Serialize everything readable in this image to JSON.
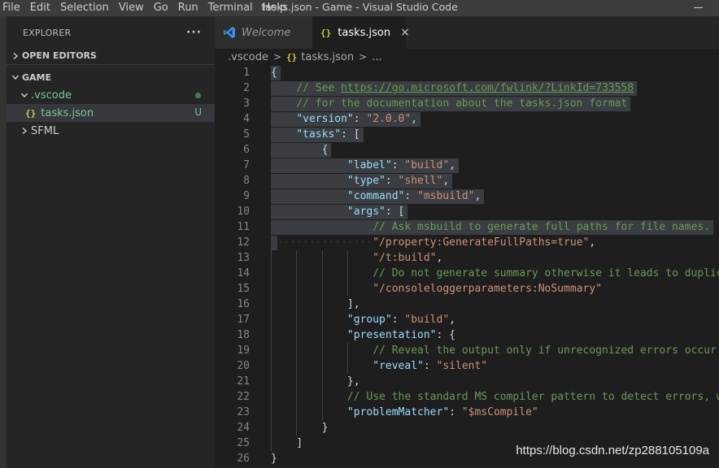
{
  "menu": [
    "File",
    "Edit",
    "Selection",
    "View",
    "Go",
    "Run",
    "Terminal",
    "Help"
  ],
  "window_title": "tasks.json - Game - Visual Studio Code",
  "sidebar": {
    "title": "EXPLORER",
    "more": "···",
    "open_editors": "OPEN EDITORS",
    "workspace": "GAME",
    "tree": [
      {
        "label": ".vscode",
        "type": "folder",
        "expanded": true,
        "status": "modified-dot"
      },
      {
        "label": "tasks.json",
        "type": "file",
        "status": "U",
        "selected": true
      },
      {
        "label": "SFML",
        "type": "folder",
        "expanded": false
      }
    ]
  },
  "tabs": [
    {
      "label": "Welcome",
      "icon": "vscode-icon",
      "active": false
    },
    {
      "label": "tasks.json",
      "icon": "json-icon",
      "active": true,
      "close": "×"
    }
  ],
  "breadcrumb": [
    ".vscode",
    "tasks.json",
    "..."
  ],
  "editor": {
    "lines": [
      {
        "n": "1",
        "text": "{"
      },
      {
        "n": "2",
        "text": "    // See https://go.microsoft.com/fwlink/?LinkId=733558"
      },
      {
        "n": "3",
        "text": "    // for the documentation about the tasks.json format"
      },
      {
        "n": "4",
        "text": "    \"version\": \"2.0.0\","
      },
      {
        "n": "5",
        "text": "    \"tasks\": ["
      },
      {
        "n": "6",
        "text": "        {"
      },
      {
        "n": "7",
        "text": "            \"label\": \"build\","
      },
      {
        "n": "8",
        "text": "            \"type\": \"shell\","
      },
      {
        "n": "9",
        "text": "            \"command\": \"msbuild\","
      },
      {
        "n": "10",
        "text": "            \"args\": ["
      },
      {
        "n": "11",
        "text": "                // Ask msbuild to generate full paths for file names."
      },
      {
        "n": "12",
        "text": "                \"/property:GenerateFullPaths=true\","
      },
      {
        "n": "13",
        "text": "                \"/t:build\","
      },
      {
        "n": "14",
        "text": "                // Do not generate summary otherwise it leads to duplica"
      },
      {
        "n": "15",
        "text": "                \"/consoleloggerparameters:NoSummary\""
      },
      {
        "n": "16",
        "text": "            ],"
      },
      {
        "n": "17",
        "text": "            \"group\": \"build\","
      },
      {
        "n": "18",
        "text": "            \"presentation\": {"
      },
      {
        "n": "19",
        "text": "                // Reveal the output only if unrecognized errors occur."
      },
      {
        "n": "20",
        "text": "                \"reveal\": \"silent\""
      },
      {
        "n": "21",
        "text": "            },"
      },
      {
        "n": "22",
        "text": "            // Use the standard MS compiler pattern to detect errors, wa"
      },
      {
        "n": "23",
        "text": "            \"problemMatcher\": \"$msCompile\""
      },
      {
        "n": "24",
        "text": "        }"
      },
      {
        "n": "25",
        "text": "    ]"
      },
      {
        "n": "26",
        "text": "}"
      }
    ],
    "selected_lines": [
      "1",
      "2",
      "3",
      "4",
      "5",
      "6",
      "7",
      "8",
      "9",
      "10",
      "11",
      "12"
    ]
  },
  "watermark": "https://blog.csdn.net/zp288105109a",
  "colors": {
    "editor_bg": "#1e1e1e",
    "sidebar_bg": "#252526",
    "titlebar_bg": "#3c3c3c",
    "selection": "#3a3d41",
    "key": "#9cdcfe",
    "string": "#ce9178",
    "comment": "#6a9955",
    "untracked": "#73c991",
    "json_icon": "#cbcb41"
  }
}
